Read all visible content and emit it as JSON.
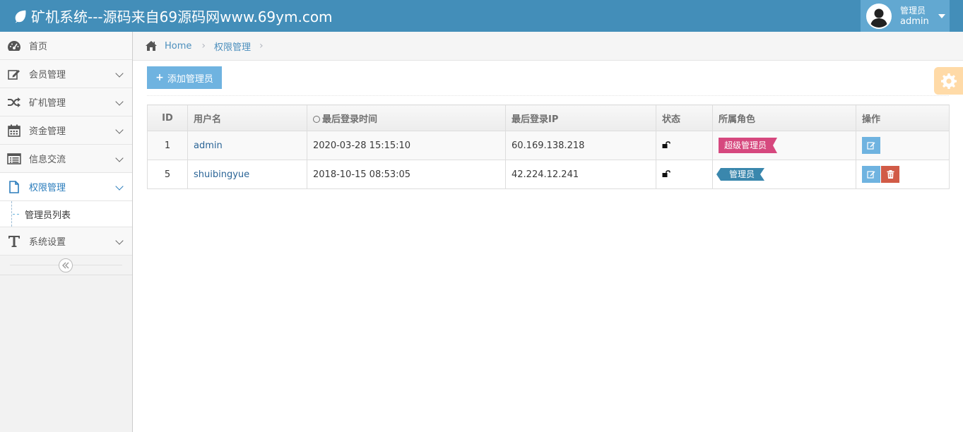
{
  "app": {
    "title": "矿机系统---源码来自69源码网www.69ym.com",
    "brand_icon": "leaf-icon"
  },
  "user": {
    "role": "管理员",
    "name": "admin",
    "avatar_icon": "user-avatar-icon"
  },
  "sidebar": {
    "items": [
      {
        "label": "首页",
        "icon": "tachometer-icon"
      },
      {
        "label": "会员管理",
        "icon": "edit-icon"
      },
      {
        "label": "矿机管理",
        "icon": "random-icon"
      },
      {
        "label": "资金管理",
        "icon": "calendar-icon"
      },
      {
        "label": "信息交流",
        "icon": "list-alt-icon"
      },
      {
        "label": "权限管理",
        "icon": "file-icon"
      },
      {
        "label": "系统设置",
        "icon": "text-icon"
      }
    ],
    "submenu": {
      "label": "管理员列表"
    },
    "collapse_icon": "double-angle-left-icon"
  },
  "breadcrumb": {
    "home": "Home",
    "current": "权限管理",
    "separator": "›"
  },
  "toolbar": {
    "add_label": "添加管理员",
    "plus": "+"
  },
  "table": {
    "headers": [
      "ID",
      "用户名",
      "最后登录时间",
      "最后登录IP",
      "状态",
      "所属角色",
      "操作"
    ],
    "rows": [
      {
        "id": "1",
        "username": "admin",
        "last_login": "2020-03-28 15:15:10",
        "ip": "60.169.138.218",
        "status_icon": "unlock-icon",
        "role": "超级管理员",
        "role_color": "#d6487e",
        "actions": [
          "edit"
        ]
      },
      {
        "id": "5",
        "username": "shuibingyue",
        "last_login": "2018-10-15 08:53:05",
        "ip": "42.224.12.241",
        "status_icon": "unlock-icon",
        "role": "管理员",
        "role_color": "#3a87ad",
        "actions": [
          "edit",
          "delete"
        ]
      }
    ]
  },
  "colors": {
    "navbar": "#438eb9",
    "user_menu": "#62a8d1",
    "link": "#2a6496",
    "accent": "#6fb3e0",
    "danger": "#d15b47",
    "settings": "#ffb752"
  }
}
